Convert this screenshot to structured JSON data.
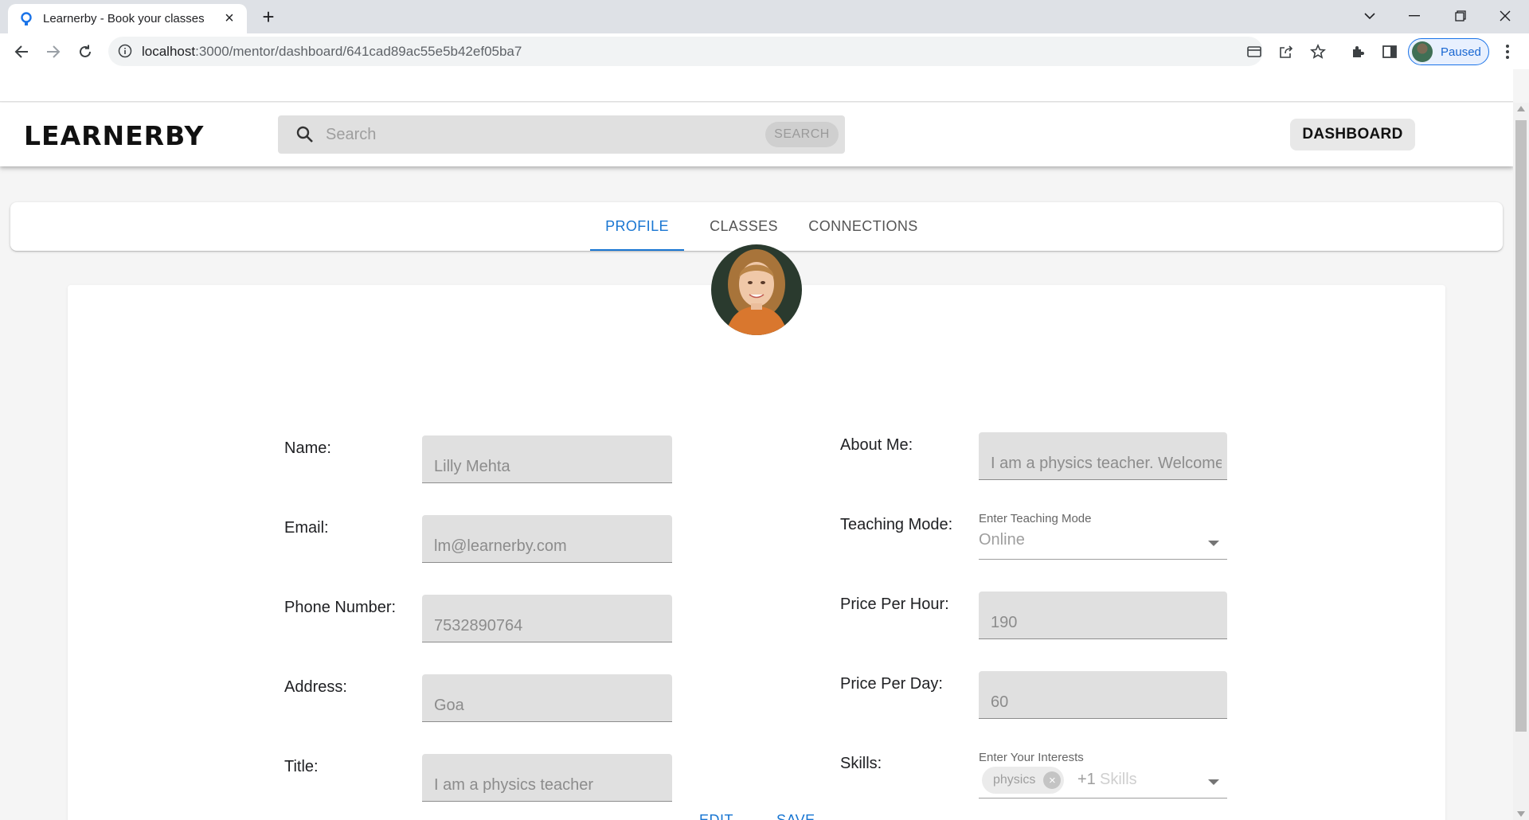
{
  "browser": {
    "tab_title": "Learnerby - Book your classes",
    "url_host": "localhost",
    "url_path": ":3000/mentor/dashboard/641cad89ac55e5b42ef05ba7",
    "profile_label": "Paused"
  },
  "app": {
    "logo": "LEARNERBY",
    "search_placeholder": "Search",
    "search_button": "SEARCH",
    "dashboard_button": "DASHBOARD"
  },
  "tabs": [
    {
      "label": "PROFILE",
      "active": true
    },
    {
      "label": "CLASSES",
      "active": false
    },
    {
      "label": "CONNECTIONS",
      "active": false
    }
  ],
  "profile": {
    "left_fields": [
      {
        "label": "Name:",
        "value": "Lilly Mehta"
      },
      {
        "label": "Email:",
        "value": "lm@learnerby.com"
      },
      {
        "label": "Phone Number:",
        "value": "7532890764"
      },
      {
        "label": "Address:",
        "value": "Goa"
      },
      {
        "label": "Title:",
        "value": "I am a physics teacher"
      }
    ],
    "about_me": {
      "label": "About Me:",
      "value": "I am a physics teacher. Welcome"
    },
    "teaching_mode": {
      "label": "Teaching Mode:",
      "caption": "Enter Teaching Mode",
      "value": "Online"
    },
    "price_per_hour": {
      "label": "Price Per Hour:",
      "value": "190"
    },
    "price_per_day": {
      "label": "Price Per Day:",
      "value": "60"
    },
    "skills": {
      "label": "Skills:",
      "caption": "Enter Your Interests",
      "chip": "physics",
      "more": "+1",
      "placeholder": "Skills"
    },
    "actions": {
      "edit": "EDIT",
      "save": "SAVE"
    }
  },
  "colors": {
    "accent": "#1976d2",
    "field_bg": "#e0e0e0",
    "page_bg": "#f5f5f5"
  }
}
